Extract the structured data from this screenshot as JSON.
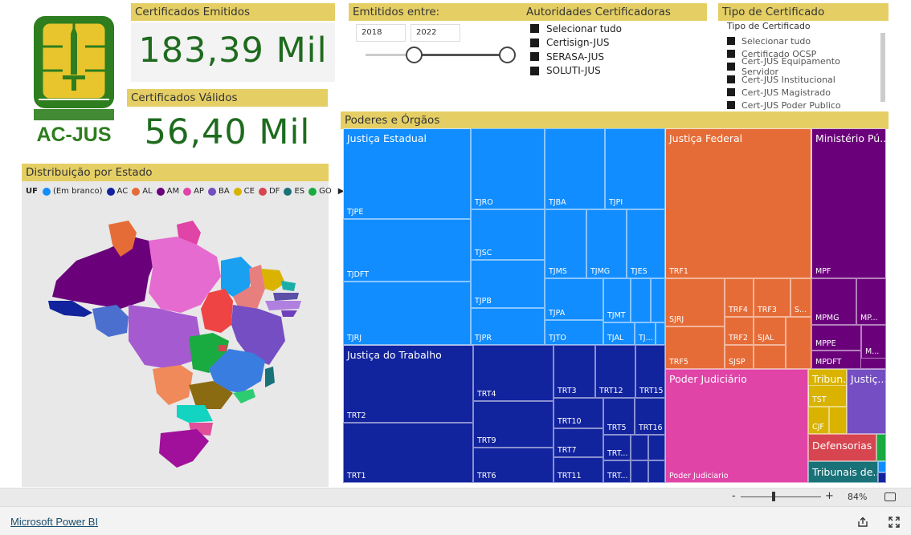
{
  "logo": {
    "text": "AC-JUS",
    "green": "#2e7d1e",
    "gold": "#e8c52c"
  },
  "kpis": {
    "emitidos_title": "Certificados Emitidos",
    "emitidos_value": "183,39 Mil",
    "validos_title": "Certificados Válidos",
    "validos_value": "56,40 Mil"
  },
  "date_filter": {
    "title": "Emtitidos entre:",
    "from": "2018",
    "to": "2022"
  },
  "autoridades": {
    "title": "Autoridades Certificadoras",
    "items": [
      "Selecionar tudo",
      "Certisign-JUS",
      "SERASA-JUS",
      "SOLUTI-JUS"
    ]
  },
  "tipo": {
    "title": "Tipo de Certificado",
    "subtitle": "Tipo de Certificado",
    "items": [
      "Selecionar tudo",
      "Certificado OCSP",
      "Cert-JUS Equipamento Servidor",
      "Cert-JUS Institucional",
      "Cert-JUS Magistrado",
      "Cert-JUS Poder Publico"
    ]
  },
  "map": {
    "title": "Distribuição por Estado",
    "legend_label": "UF",
    "legend": [
      {
        "name": "(Em branco)",
        "color": "#118dff"
      },
      {
        "name": "AC",
        "color": "#12239e"
      },
      {
        "name": "AL",
        "color": "#e66c37"
      },
      {
        "name": "AM",
        "color": "#6b007b"
      },
      {
        "name": "AP",
        "color": "#e044a7"
      },
      {
        "name": "BA",
        "color": "#744ec2"
      },
      {
        "name": "CE",
        "color": "#d9b300"
      },
      {
        "name": "DF",
        "color": "#d64550"
      },
      {
        "name": "ES",
        "color": "#197278"
      },
      {
        "name": "GO",
        "color": "#1aab40"
      }
    ]
  },
  "treemap": {
    "title": "Poderes e Órgãos",
    "groups": {
      "estadual": "Justiça Estadual",
      "federal": "Justiça Federal",
      "mp": "Ministério Pú...",
      "trabalho": "Justiça do Trabalho",
      "judiciario": "Poder Judiciário",
      "tribunais_sup": "Tribun...",
      "justica_outros": "Justiç...",
      "defensorias": "Defensorias",
      "tribunais_contas": "Tribunais de..."
    },
    "cells": {
      "tjpe": "TJPE",
      "tjdft": "TJDFT",
      "tjrj": "TJRJ",
      "tjro": "TJRO",
      "tjsc": "TJSC",
      "tjpb": "TJPB",
      "tjpr": "TJPR",
      "tjba": "TJBA",
      "tjpi": "TJPI",
      "tjms": "TJMS",
      "tjmg": "TJMG",
      "tjes": "TJES",
      "tjpa": "TJPA",
      "tjmt": "TJMT",
      "tjto": "TJTO",
      "tjal": "TJAL",
      "tjx": "TJ...",
      "trf1": "TRF1",
      "sjrj": "SJRJ",
      "trf4": "TRF4",
      "trf3": "TRF3",
      "sx": "S...",
      "trf2": "TRF2",
      "sjal": "SJAL",
      "trf5": "TRF5",
      "sjsp": "SJSP",
      "mpf": "MPF",
      "mpmg": "MPMG",
      "mpx": "MP...",
      "mppe": "MPPE",
      "mx": "M...",
      "mpdft": "MPDFT",
      "trt2": "TRT2",
      "trt1": "TRT1",
      "trt4": "TRT4",
      "trt9": "TRT9",
      "trt6": "TRT6",
      "trt3": "TRT3",
      "trt12": "TRT12",
      "trt15": "TRT15",
      "trt10": "TRT10",
      "trt5": "TRT5",
      "trt16": "TRT16",
      "trt7": "TRT7",
      "trtx1": "TRT...",
      "trt11": "TRT11",
      "trtx2": "TRT...",
      "poder_judiciario": "Poder Judiciario",
      "tst": "TST",
      "cjf": "CJF"
    }
  },
  "statusbar": {
    "minus": "-",
    "plus": "+",
    "zoom": "84%"
  },
  "footer": {
    "link": "Microsoft Power BI"
  }
}
